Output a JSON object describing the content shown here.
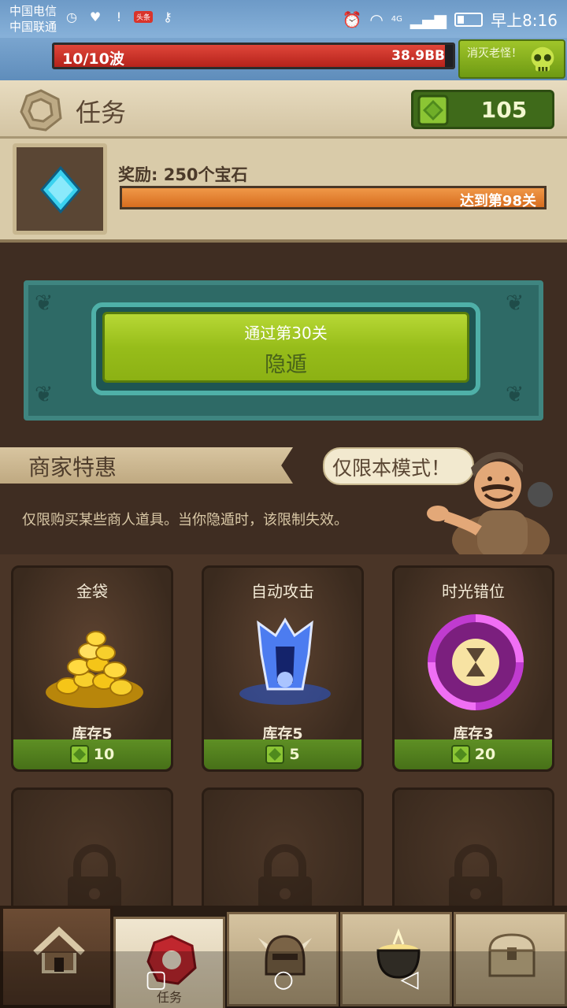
{
  "status_bar": {
    "carrier_1": "中国电信",
    "carrier_2": "中国联通",
    "badge": "头条",
    "network": "4G",
    "time": "早上8:16"
  },
  "hud": {
    "wave": "10/10波",
    "boss_hp": "38.9BB",
    "boss_hp_fraction": 0.98,
    "boss_button": "消灭老怪！"
  },
  "quest": {
    "title": "任务",
    "gems": "105"
  },
  "reward": {
    "label": "奖励: 250个宝石",
    "progress_text": "达到第98关",
    "progress_fraction": 1.0
  },
  "hide_panel": {
    "subtitle": "通过第30关",
    "button_label": "隐遁"
  },
  "merchant": {
    "title": "商家特惠",
    "bubble": "仅限本模式！",
    "description": "仅限购买某些商人道具。当你隐遁时，该限制失效。"
  },
  "shop": {
    "items": [
      {
        "name": "金袋",
        "stock": "库存5",
        "price": "10",
        "icon": "gold-coins-icon"
      },
      {
        "name": "自动攻击",
        "stock": "库存5",
        "price": "5",
        "icon": "auto-attack-icon"
      },
      {
        "name": "时光错位",
        "stock": "库存3",
        "price": "20",
        "icon": "time-warp-icon"
      }
    ],
    "locked_slots": 3
  },
  "bottom_nav": {
    "tabs": [
      {
        "icon": "home-icon"
      },
      {
        "icon": "quest-icon",
        "label": "任务",
        "active": true
      },
      {
        "icon": "helmet-icon"
      },
      {
        "icon": "cauldron-icon"
      },
      {
        "icon": "chest-icon"
      }
    ]
  },
  "colors": {
    "gem_green": "#5e8f24",
    "wave_red": "#d13a2f",
    "reward_orange": "#e6812f",
    "panel_teal": "#2e6a66",
    "button_lime": "#a4c928"
  }
}
